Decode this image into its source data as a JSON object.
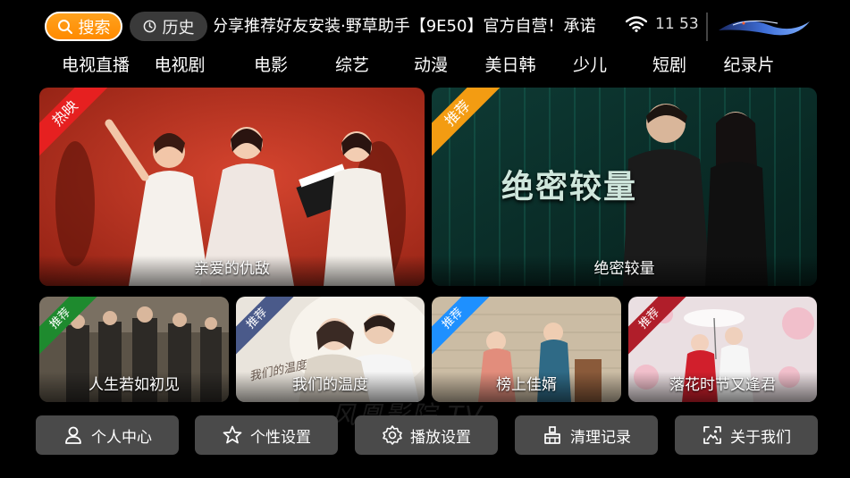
{
  "topbar": {
    "search_label": "搜索",
    "history_label": "历史",
    "marquee_text": "分享推荐好友安装·野草助手【9E50】官方自营！承诺",
    "clock": "11 53"
  },
  "nav": {
    "items": [
      "电视直播",
      "电视剧",
      "电影",
      "综艺",
      "动漫",
      "美日韩",
      "少儿",
      "短剧",
      "纪录片"
    ]
  },
  "featured": [
    {
      "title": "亲爱的仇敌",
      "badge": "热映",
      "badge_color": "#e62020"
    },
    {
      "title": "绝密较量",
      "badge": "推荐",
      "badge_color": "#f39c12",
      "poster_text": "绝密较量"
    }
  ],
  "recommended": [
    {
      "title": "人生若如初见",
      "badge": "推荐",
      "badge_color": "#1e8a2e"
    },
    {
      "title": "我们的温度",
      "badge": "推荐",
      "badge_color": "#4a5a8a",
      "poster_text": "我们的温度"
    },
    {
      "title": "榜上佳婿",
      "badge": "推荐",
      "badge_color": "#1e90ff"
    },
    {
      "title": "落花时节又逢君",
      "badge": "推荐",
      "badge_color": "#b01e2a"
    }
  ],
  "bottom_buttons": [
    {
      "label": "个人中心",
      "icon": "person-icon"
    },
    {
      "label": "个性设置",
      "icon": "star-icon"
    },
    {
      "label": "播放设置",
      "icon": "gear-icon"
    },
    {
      "label": "清理记录",
      "icon": "broom-icon"
    },
    {
      "label": "关于我们",
      "icon": "image-icon"
    }
  ],
  "watermark": "风凰影院 TV"
}
